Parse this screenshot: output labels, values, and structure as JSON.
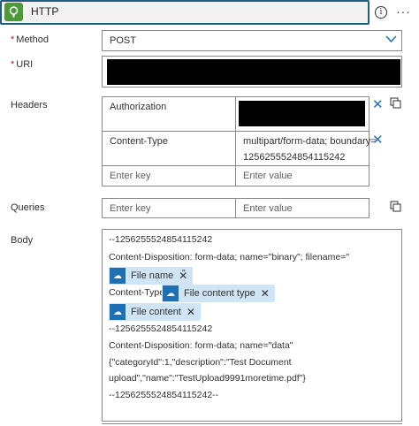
{
  "header": {
    "title": "HTTP",
    "info_icon": "info-icon",
    "more": "···"
  },
  "method": {
    "label": "Method",
    "required": "*",
    "value": "POST"
  },
  "uri": {
    "label": "URI",
    "required": "*"
  },
  "headers": {
    "label": "Headers",
    "rows": [
      {
        "key": "Authorization",
        "value": ""
      },
      {
        "key": "Content-Type",
        "value_line1": "multipart/form-data; boundary=",
        "value_line2": "1256255524854115242"
      }
    ],
    "key_placeholder": "Enter key",
    "value_placeholder": "Enter value"
  },
  "queries": {
    "label": "Queries",
    "key_placeholder": "Enter key",
    "value_placeholder": "Enter value"
  },
  "body": {
    "label": "Body",
    "line1": "--1256255524854115242",
    "line2": "Content-Disposition: form-data; name=\"binary\"; filename=\"",
    "token_file_name": "File name",
    "quote": "\"",
    "content_type_label": "Content-Type:",
    "token_file_content_type": "File content type",
    "token_file_content": "File content",
    "line3": "--1256255524854115242",
    "line4": "Content-Disposition: form-data; name=\"data\"",
    "line5": "{\"categoryId\":1,\"description\":\"Test Document",
    "line6": "upload\",\"name\":\"TestUpload9991moretime.pdf\"}",
    "line7": "--1256255524854115242--"
  },
  "colors": {
    "accent": "#1f6fb4",
    "header_border": "#1f5f7a",
    "connector": "#4e9a3a",
    "token_bg": "#cfe4f4"
  }
}
